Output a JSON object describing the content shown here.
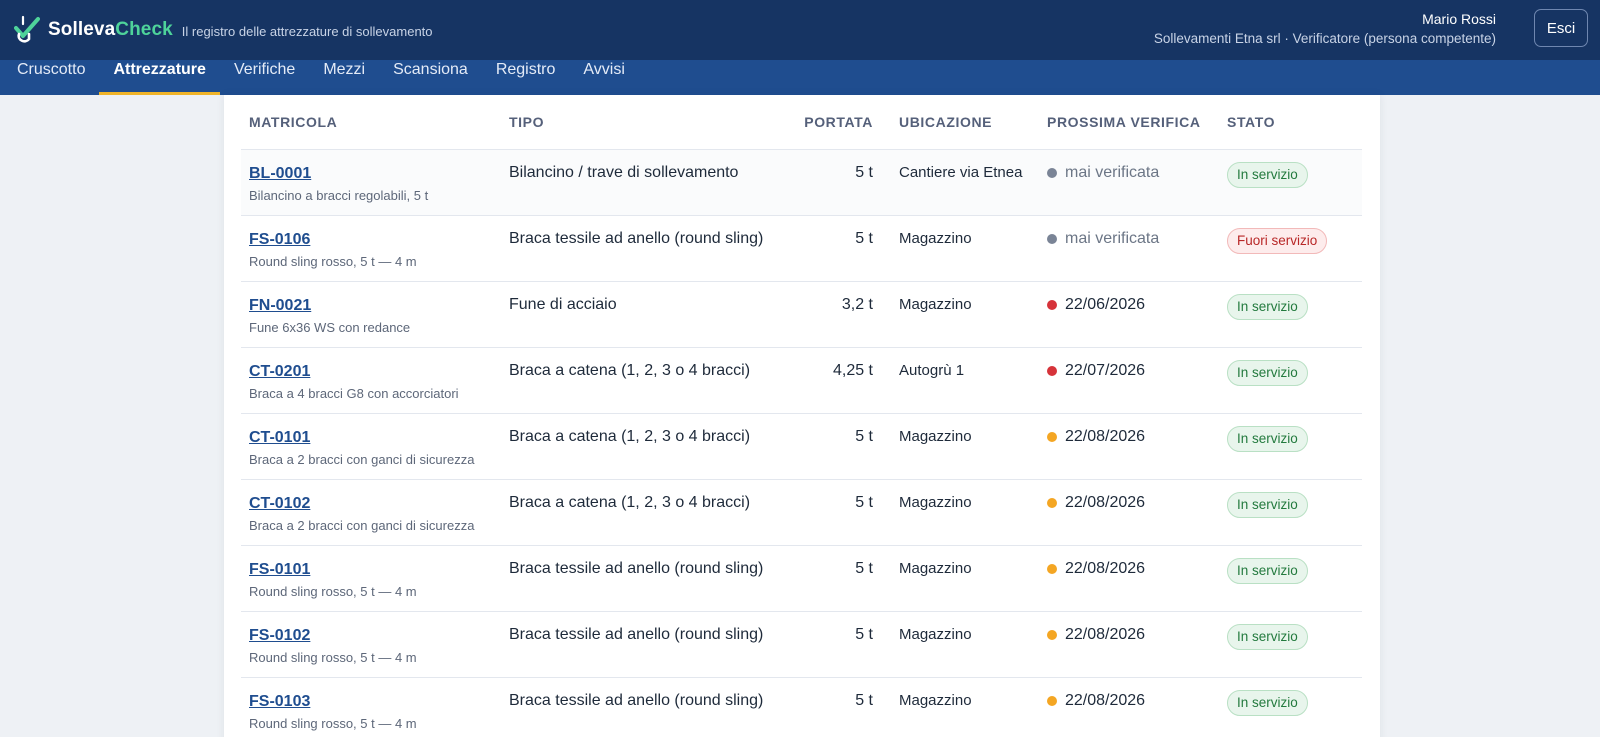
{
  "app": {
    "brand_part1": "Solleva",
    "brand_part2": "Check",
    "tagline": "Il registro delle attrezzature di sollevamento",
    "logo_icon": "checkmark-hook-logo"
  },
  "user": {
    "name": "Mario Rossi",
    "org": "Sollevamenti Etna srl · Verificatore (persona competente)",
    "logout_label": "Esci"
  },
  "nav": {
    "items": [
      {
        "label": "Cruscotto"
      },
      {
        "label": "Attrezzature"
      },
      {
        "label": "Verifiche"
      },
      {
        "label": "Mezzi"
      },
      {
        "label": "Scansiona"
      },
      {
        "label": "Registro"
      },
      {
        "label": "Avvisi"
      }
    ],
    "active": "Attrezzature"
  },
  "colors": {
    "header": "#163463",
    "nav": "#1f4d8f",
    "active_underline": "#f0b429",
    "dot_grey": "#7a8496",
    "dot_red": "#d6333a",
    "dot_orange": "#f4a623"
  },
  "table": {
    "headers": {
      "matricola": "MATRICOLA",
      "tipo": "TIPO",
      "portata": "PORTATA",
      "ubicazione": "UBICAZIONE",
      "prossima": "PROSSIMA VERIFICA",
      "stato": "STATO"
    },
    "rows": [
      {
        "code": "BL-0001",
        "desc": "Bilancino a bracci regolabili, 5 t",
        "tipo": "Bilancino / trave di sollevamento",
        "portata": "5 t",
        "ubicazione": "Cantiere via Etnea",
        "prossima": "mai verificata",
        "dot": "grey",
        "stato": "In servizio",
        "stato_type": "ok"
      },
      {
        "code": "FS-0106",
        "desc": "Round sling rosso, 5 t — 4 m",
        "tipo": "Braca tessile ad anello (round sling)",
        "portata": "5 t",
        "ubicazione": "Magazzino",
        "prossima": "mai verificata",
        "dot": "grey",
        "stato": "Fuori servizio",
        "stato_type": "ko"
      },
      {
        "code": "FN-0021",
        "desc": "Fune 6x36 WS con redance",
        "tipo": "Fune di acciaio",
        "portata": "3,2 t",
        "ubicazione": "Magazzino",
        "prossima": "22/06/2026",
        "dot": "red",
        "stato": "In servizio",
        "stato_type": "ok"
      },
      {
        "code": "CT-0201",
        "desc": "Braca a 4 bracci G8 con accorciatori",
        "tipo": "Braca a catena (1, 2, 3 o 4 bracci)",
        "portata": "4,25 t",
        "ubicazione": "Autogrù 1",
        "prossima": "22/07/2026",
        "dot": "red",
        "stato": "In servizio",
        "stato_type": "ok"
      },
      {
        "code": "CT-0101",
        "desc": "Braca a 2 bracci con ganci di sicurezza",
        "tipo": "Braca a catena (1, 2, 3 o 4 bracci)",
        "portata": "5 t",
        "ubicazione": "Magazzino",
        "prossima": "22/08/2026",
        "dot": "orange",
        "stato": "In servizio",
        "stato_type": "ok"
      },
      {
        "code": "CT-0102",
        "desc": "Braca a 2 bracci con ganci di sicurezza",
        "tipo": "Braca a catena (1, 2, 3 o 4 bracci)",
        "portata": "5 t",
        "ubicazione": "Magazzino",
        "prossima": "22/08/2026",
        "dot": "orange",
        "stato": "In servizio",
        "stato_type": "ok"
      },
      {
        "code": "FS-0101",
        "desc": "Round sling rosso, 5 t — 4 m",
        "tipo": "Braca tessile ad anello (round sling)",
        "portata": "5 t",
        "ubicazione": "Magazzino",
        "prossima": "22/08/2026",
        "dot": "orange",
        "stato": "In servizio",
        "stato_type": "ok"
      },
      {
        "code": "FS-0102",
        "desc": "Round sling rosso, 5 t — 4 m",
        "tipo": "Braca tessile ad anello (round sling)",
        "portata": "5 t",
        "ubicazione": "Magazzino",
        "prossima": "22/08/2026",
        "dot": "orange",
        "stato": "In servizio",
        "stato_type": "ok"
      },
      {
        "code": "FS-0103",
        "desc": "Round sling rosso, 5 t — 4 m",
        "tipo": "Braca tessile ad anello (round sling)",
        "portata": "5 t",
        "ubicazione": "Magazzino",
        "prossima": "22/08/2026",
        "dot": "orange",
        "stato": "In servizio",
        "stato_type": "ok"
      }
    ]
  }
}
